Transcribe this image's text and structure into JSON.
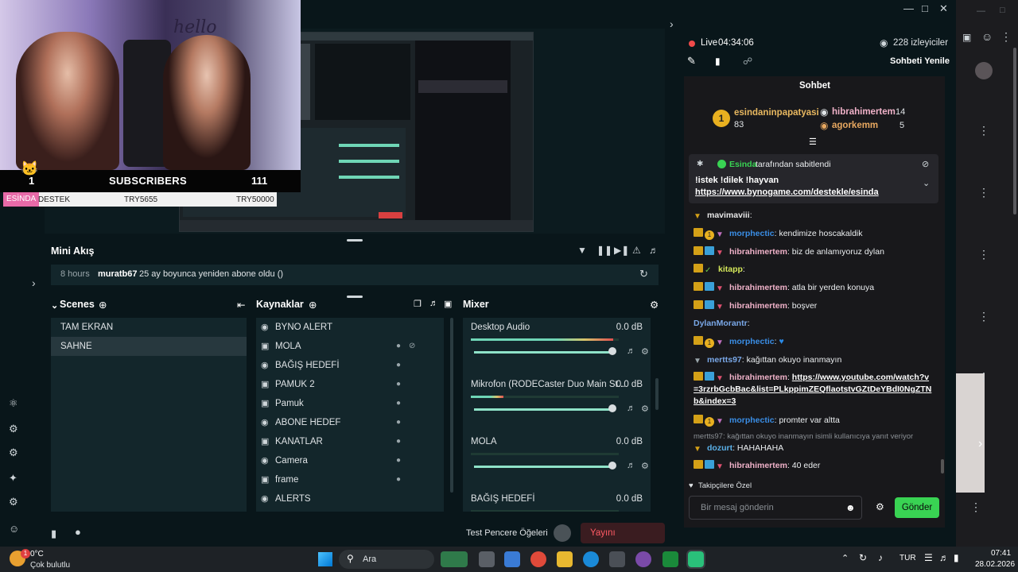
{
  "stream": {
    "live_label": "Live",
    "live_time": "04:34:06",
    "viewers": "228 izleyiciler",
    "refresh_chat": "Sohbeti Yenile",
    "chat_title": "Sohbet"
  },
  "overlay": {
    "sub_count": "1",
    "subscribers_label": "SUBSCRIBERS",
    "sub_goal": "111",
    "goal_tag": "ESİNDA",
    "goal_name": "DESTEK",
    "goal_current": "TRY5655",
    "goal_target": "TRY50000",
    "hello": "hello"
  },
  "mini_feed": {
    "title": "Mini Akış",
    "time": "8 hours",
    "user": "muratb67",
    "text": "25 ay boyunca yeniden abone oldu ()"
  },
  "scenes": {
    "title": "Scenes",
    "items": [
      "TAM EKRAN",
      "SAHNE"
    ]
  },
  "sources": {
    "title": "Kaynaklar",
    "items": [
      "BYNO ALERT",
      "MOLA",
      "BAĞIŞ HEDEFİ",
      "PAMUK 2",
      "Pamuk",
      "ABONE HEDEF",
      "KANATLAR",
      "Camera",
      "frame",
      "ALERTS"
    ]
  },
  "mixer": {
    "title": "Mixer",
    "channels": [
      {
        "name": "Desktop Audio",
        "db": "0.0 dB",
        "level": 0.98
      },
      {
        "name": "Mikrofon (RODECaster Duo Main St...",
        "db": "0.0 dB",
        "level": 0.98
      },
      {
        "name": "MOLA",
        "db": "0.0 dB",
        "level": 0.98
      },
      {
        "name": "BAĞIŞ HEDEFİ",
        "db": "0.0 dB",
        "level": 0.98
      }
    ]
  },
  "status": {
    "test_label": "Test Pencere Öğeleri",
    "end_stream": "Yayını Sonlandır"
  },
  "leaderboard": {
    "top_user": "esindaninpapatyasi",
    "top_value": "83",
    "second_user": "hibrahimertem",
    "second_value": "14",
    "third_user": "agorkemm",
    "third_value": "5"
  },
  "pinned": {
    "by_user": "Esinda",
    "by_text": "tarafından sabitlendi",
    "line1": "!istek !dilek !hayvan",
    "link": "https://www.bynogame.com/destekle/esinda"
  },
  "messages": [
    {
      "user": "mavimaviii",
      "sep": ":",
      "text": "",
      "ucolor": "#e8e8e8"
    },
    {
      "user": "morphectic",
      "sep": ":",
      "text": "kendimize hoscakaldik",
      "ucolor": "#3a8ee6"
    },
    {
      "user": "hibrahimertem",
      "sep": ":",
      "text": "biz de anlamıyoruz dylan",
      "ucolor": "#f0b2c9"
    },
    {
      "user": "kitapp",
      "sep": ":",
      "text": "",
      "ucolor": "#d5e85a"
    },
    {
      "user": "hibrahimertem",
      "sep": ":",
      "text": "atla bir yerden konuya",
      "ucolor": "#f0b2c9"
    },
    {
      "user": "hibrahimertem",
      "sep": ":",
      "text": "boşver",
      "ucolor": "#f0b2c9"
    },
    {
      "user": "DylanMorantr",
      "sep": ":",
      "text": "",
      "ucolor": "#7aa8e8"
    },
    {
      "user": "morphectic",
      "sep": ":",
      "text": "",
      "ucolor": "#3a8ee6"
    },
    {
      "user": "mertts97",
      "sep": ":",
      "text": "kağıttan okuyo inanmayın",
      "ucolor": "#7aa8e8"
    },
    {
      "user": "hibrahimertem",
      "sep": ":",
      "text": "https://www.youtube.com/watch?v=3rzrbGcbBac&list=PLkppimZEQflaotstvGZtDeYBdI0NgZTNb&index=3",
      "ucolor": "#f0b2c9"
    },
    {
      "user": "morphectic",
      "sep": ":",
      "text": "promter var altta",
      "ucolor": "#3a8ee6"
    },
    {
      "user": "dozurt",
      "sep": ":",
      "text": "HAHAHAHA",
      "ucolor": "#5ab0e8"
    },
    {
      "user": "hibrahimertem",
      "sep": ":",
      "text": "40 eder",
      "ucolor": "#f0b2c9"
    }
  ],
  "reply_note": "mertts97: kağıttan okuyo inanmayın isimli kullanıcıya yanıt veriyor",
  "follower_only": "Takipçilere Özel",
  "chat_placeholder": "Bir mesaj gönderin",
  "send_label": "Gönder",
  "taskbar": {
    "weather_temp": "0°C",
    "weather_desc": "Çok bulutlu",
    "search": "Ara",
    "lang": "TUR",
    "time": "07:41",
    "date": "28.02.2026",
    "badge": "1"
  }
}
